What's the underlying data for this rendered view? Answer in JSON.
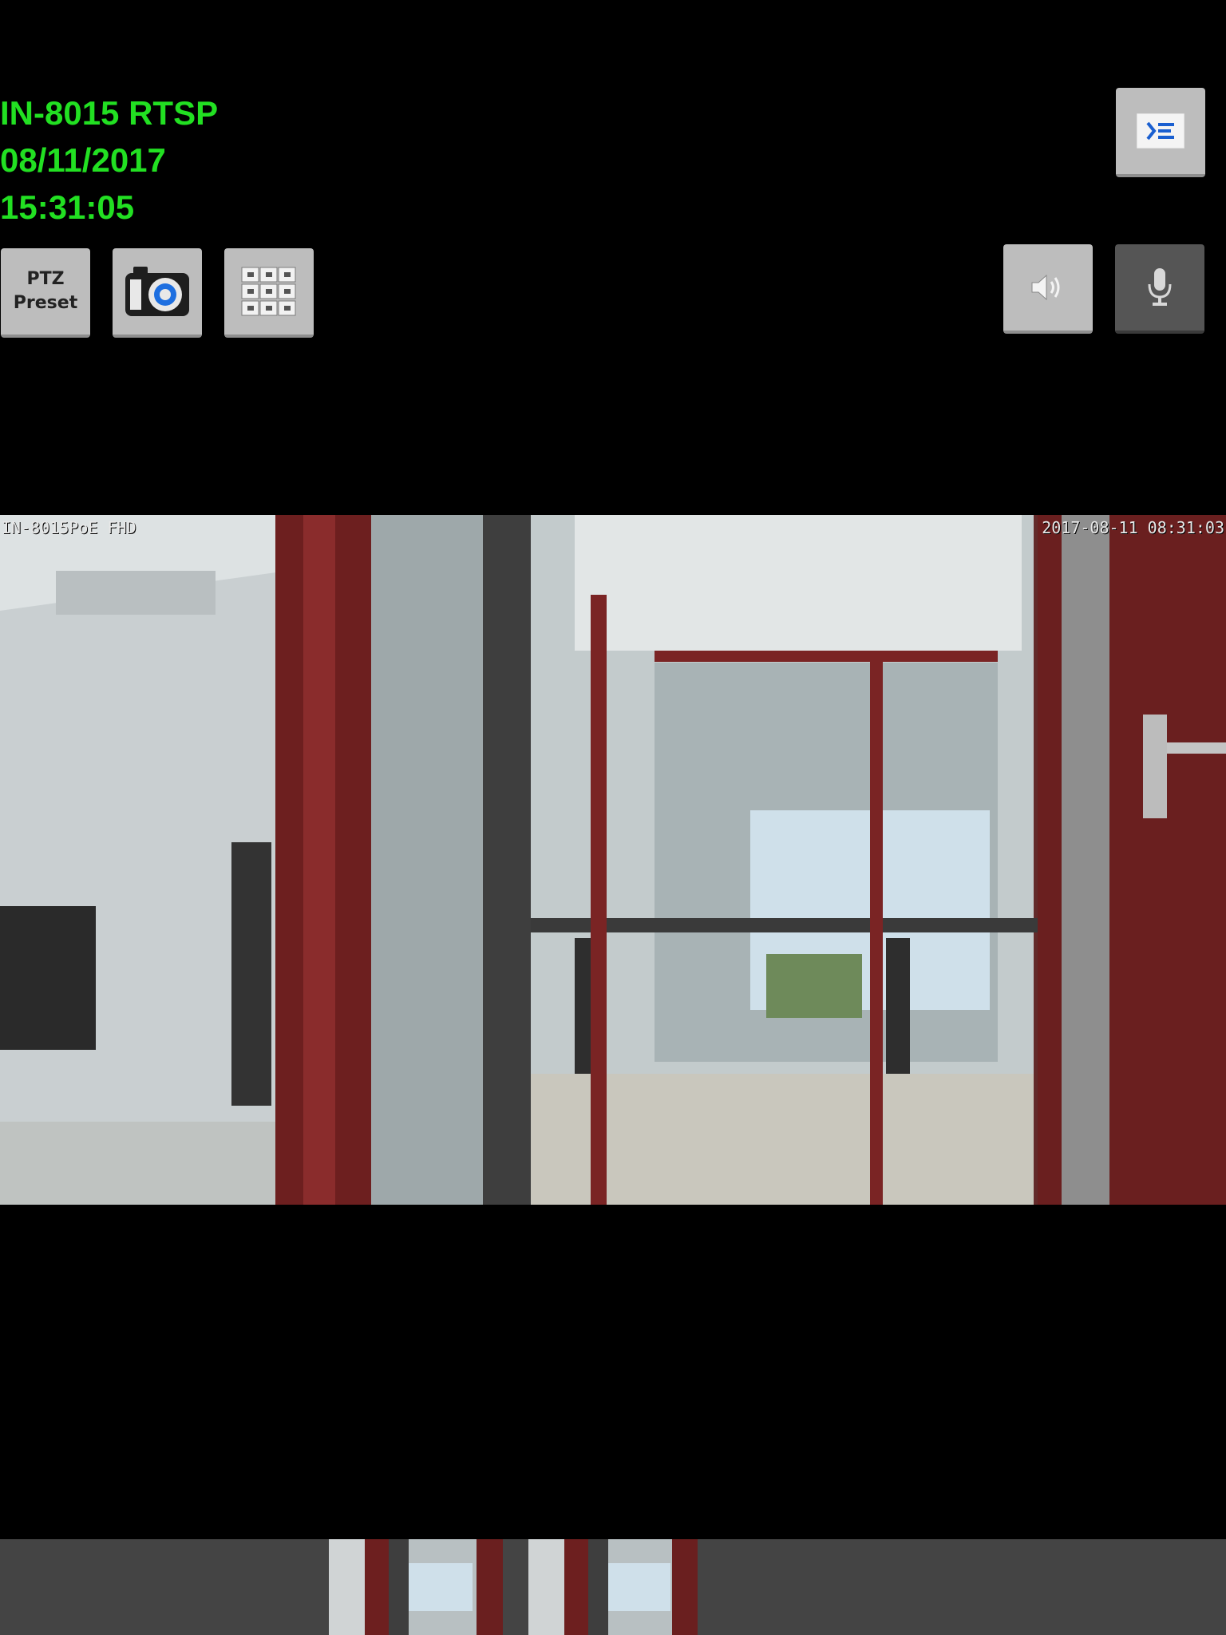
{
  "camera": {
    "name": "IN-8015 RTSP",
    "date": "08/11/2017",
    "time": "15:31:05"
  },
  "toolbar": {
    "ptz_line1": "PTZ",
    "ptz_line2": "Preset",
    "snapshot_icon": "camera-icon",
    "grid_icon": "multiview-grid-icon",
    "menu_icon": "menu-toggle-icon",
    "speaker_icon": "speaker-icon",
    "mic_icon": "microphone-icon"
  },
  "video": {
    "osd_name": "IN-8015PoE FHD",
    "osd_timestamp": "2017-08-11 08:31:03"
  },
  "colors": {
    "info_text": "#22e022",
    "button_bg": "#bdbdbd",
    "button_dark_bg": "#555555",
    "bottom_bar_bg": "#444444"
  }
}
